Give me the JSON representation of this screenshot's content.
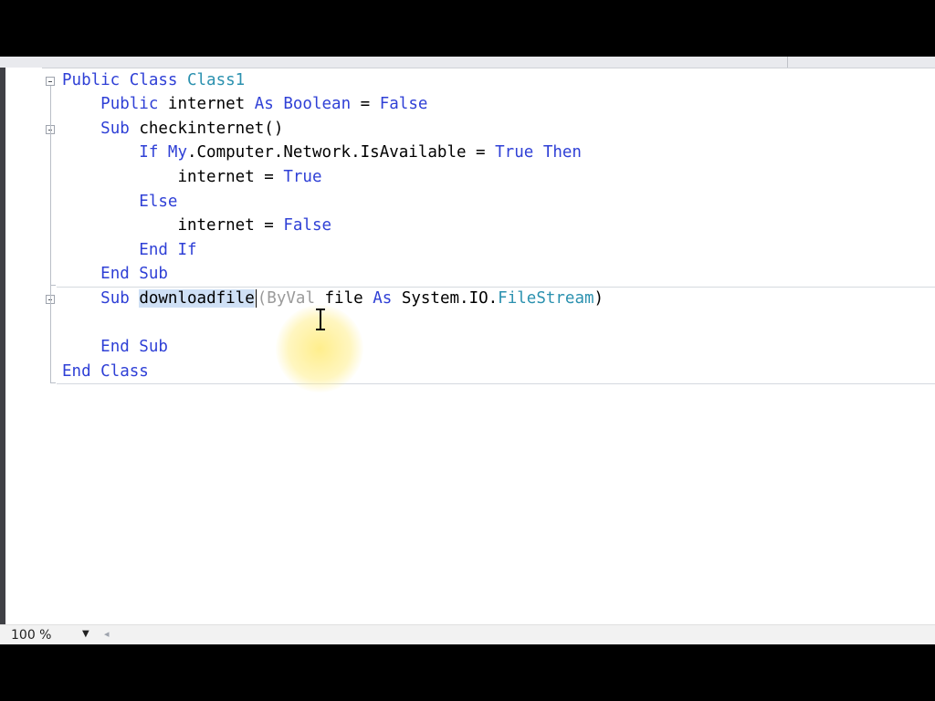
{
  "editor": {
    "lines": [
      {
        "indent": "",
        "tokens": [
          {
            "t": "Public ",
            "c": "kw"
          },
          {
            "t": "Class ",
            "c": "kw"
          },
          {
            "t": "Class1",
            "c": "ty"
          }
        ]
      },
      {
        "indent": "    ",
        "tokens": [
          {
            "t": "Public ",
            "c": "kw"
          },
          {
            "t": "internet ",
            "c": "id"
          },
          {
            "t": "As ",
            "c": "kw"
          },
          {
            "t": "Boolean",
            "c": "kw"
          },
          {
            "t": " = ",
            "c": "id"
          },
          {
            "t": "False",
            "c": "kw"
          }
        ]
      },
      {
        "indent": "    ",
        "tokens": [
          {
            "t": "Sub ",
            "c": "kw"
          },
          {
            "t": "checkinternet()",
            "c": "id"
          }
        ]
      },
      {
        "indent": "        ",
        "tokens": [
          {
            "t": "If ",
            "c": "kw"
          },
          {
            "t": "My",
            "c": "kw"
          },
          {
            "t": ".Computer.Network.IsAvailable = ",
            "c": "id"
          },
          {
            "t": "True ",
            "c": "kw"
          },
          {
            "t": "Then",
            "c": "kw"
          }
        ]
      },
      {
        "indent": "            ",
        "tokens": [
          {
            "t": "internet = ",
            "c": "id"
          },
          {
            "t": "True",
            "c": "kw"
          }
        ]
      },
      {
        "indent": "        ",
        "tokens": [
          {
            "t": "Else",
            "c": "kw"
          }
        ]
      },
      {
        "indent": "            ",
        "tokens": [
          {
            "t": "internet = ",
            "c": "id"
          },
          {
            "t": "False",
            "c": "kw"
          }
        ]
      },
      {
        "indent": "        ",
        "tokens": [
          {
            "t": "End If",
            "c": "kw"
          }
        ]
      },
      {
        "indent": "    ",
        "tokens": [
          {
            "t": "End Sub",
            "c": "kw"
          }
        ]
      },
      {
        "indent": "    ",
        "tokens": [
          {
            "t": "Sub ",
            "c": "kw"
          },
          {
            "t": "downloadfile",
            "c": "sel"
          },
          {
            "t": "|",
            "c": "caret"
          },
          {
            "t": "(",
            "c": "gray"
          },
          {
            "t": "ByVal ",
            "c": "gray"
          },
          {
            "t": "file ",
            "c": "id"
          },
          {
            "t": "As ",
            "c": "kw"
          },
          {
            "t": "System.IO.",
            "c": "id"
          },
          {
            "t": "FileStream",
            "c": "ty"
          },
          {
            "t": ")",
            "c": "id"
          }
        ]
      },
      {
        "indent": "",
        "tokens": []
      },
      {
        "indent": "    ",
        "tokens": [
          {
            "t": "End Sub",
            "c": "kw"
          }
        ]
      },
      {
        "indent": "",
        "tokens": [
          {
            "t": "End Class",
            "c": "kw"
          }
        ]
      }
    ]
  },
  "status": {
    "zoom": "100 %"
  },
  "colors": {
    "keyword": "#2f40d6",
    "type": "#2b91af",
    "selection": "#cfe0f5"
  }
}
